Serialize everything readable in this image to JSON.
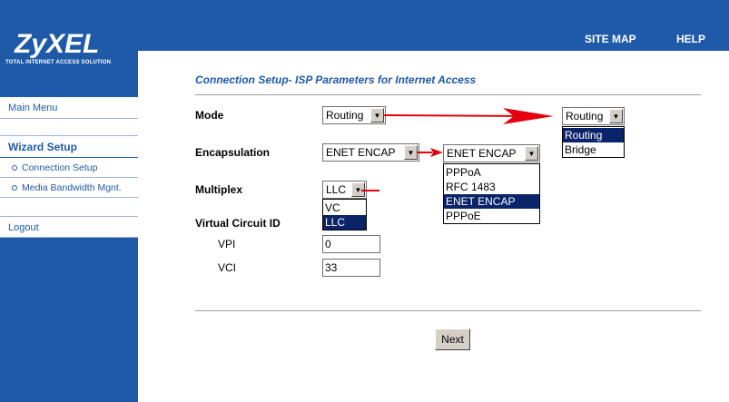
{
  "header": {
    "logo_text": "ZyXEL",
    "logo_tagline": "TOTAL INTERNET ACCESS SOLUTION",
    "site_map_label": "SITE MAP",
    "help_label": "HELP"
  },
  "sidebar": {
    "main_menu": "Main Menu",
    "wizard_setup": "Wizard Setup",
    "items": [
      {
        "label": "Connection Setup"
      },
      {
        "label": "Media Bandwidth Mgnt."
      }
    ],
    "logout": "Logout"
  },
  "page": {
    "title": "Connection Setup- ISP Parameters for Internet Access"
  },
  "form": {
    "mode": {
      "label": "Mode",
      "value": "Routing",
      "expanded_value": "Routing",
      "options": [
        "Routing",
        "Bridge"
      ],
      "selected_option": "Routing"
    },
    "encapsulation": {
      "label": "Encapsulation",
      "value": "ENET ENCAP",
      "expanded_value": "ENET ENCAP",
      "options": [
        "PPPoA",
        "RFC 1483",
        "ENET ENCAP",
        "PPPoE"
      ],
      "selected_option": "ENET ENCAP"
    },
    "multiplex": {
      "label": "Multiplex",
      "value": "LLC",
      "options": [
        "VC",
        "LLC"
      ],
      "selected_option": "LLC"
    },
    "virtual_circuit": {
      "label": "Virtual Circuit ID",
      "vpi_label": "VPI",
      "vpi_value": "0",
      "vci_label": "VCI",
      "vci_value": "33"
    },
    "next_button": "Next"
  },
  "colors": {
    "brand_blue": "#1e5aa8",
    "annotation_arrow": "#e3000f",
    "selection": "#0a246a"
  }
}
